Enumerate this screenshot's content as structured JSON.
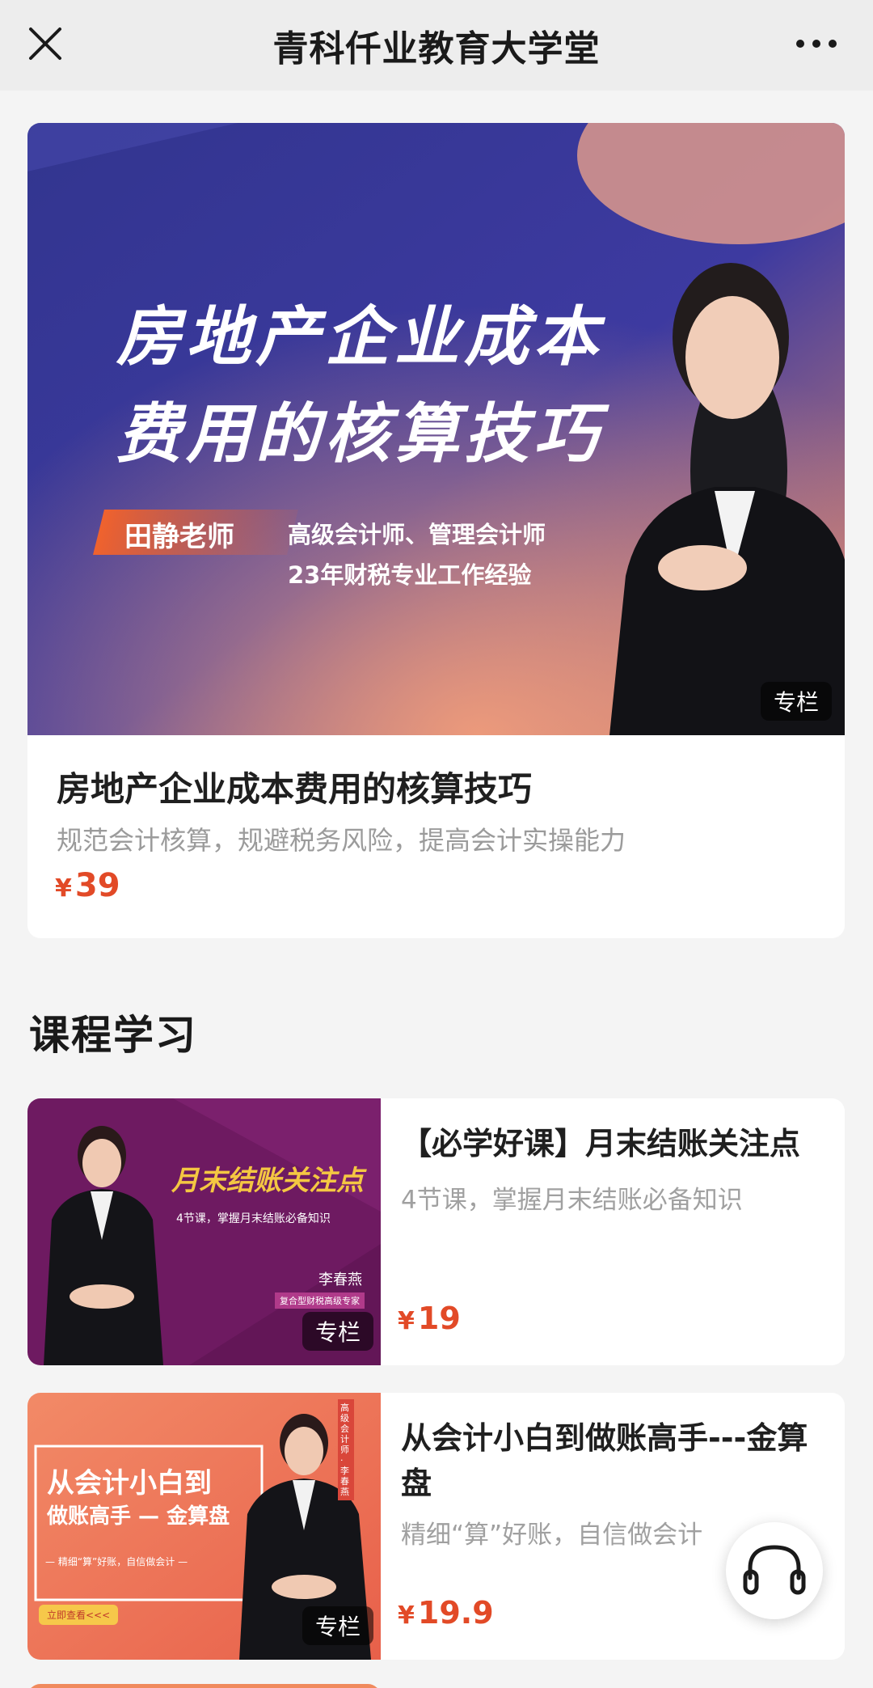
{
  "header": {
    "title": "青科仟业教育大学堂",
    "close_icon": "close-icon",
    "more_icon": "more-dots-icon"
  },
  "hero": {
    "banner_title_line1": "房地产企业成本",
    "banner_title_line2": "费用的核算技巧",
    "teacher_badge": "田静老师",
    "teacher_desc_line1": "高级会计师、管理会计师",
    "teacher_desc_line2": "23年财税专业工作经验",
    "tag": "专栏",
    "title": "房地产企业成本费用的核算技巧",
    "subtitle": "规范会计核算，规避税务风险，提高会计实操能力",
    "currency": "¥",
    "price": "39"
  },
  "section": {
    "title": "课程学习"
  },
  "courses": [
    {
      "thumb_title": "月末结账关注点",
      "thumb_desc": "4节课，掌握月末结账必备知识",
      "thumb_teacher": "李春燕",
      "thumb_teacher_role": "复合型财税高级专家",
      "tag": "专栏",
      "title": "【必学好课】月末结账关注点",
      "subtitle": "4节课，掌握月末结账必备知识",
      "currency": "¥",
      "price": "19"
    },
    {
      "thumb_title_line1": "从会计小白到",
      "thumb_title_line2": "做账高手 — 金算盘",
      "thumb_slogan": "— 精细“算”好账，自信做会计 —",
      "thumb_button": "立即查看<<<",
      "thumb_side_text": "高级会计师 · 李春燕",
      "tag": "专栏",
      "title": "从会计小白到做账高手---金算盘",
      "subtitle": "精细“算”好账，自信做会计",
      "currency": "¥",
      "price": "19.9"
    }
  ],
  "support_icon": "headset-icon",
  "colors": {
    "accent_price": "#e24a27",
    "hero_bg": "#3a3a9e",
    "course1_bg": "#7a1f6a",
    "course2_bg": "#ef7b5c"
  }
}
